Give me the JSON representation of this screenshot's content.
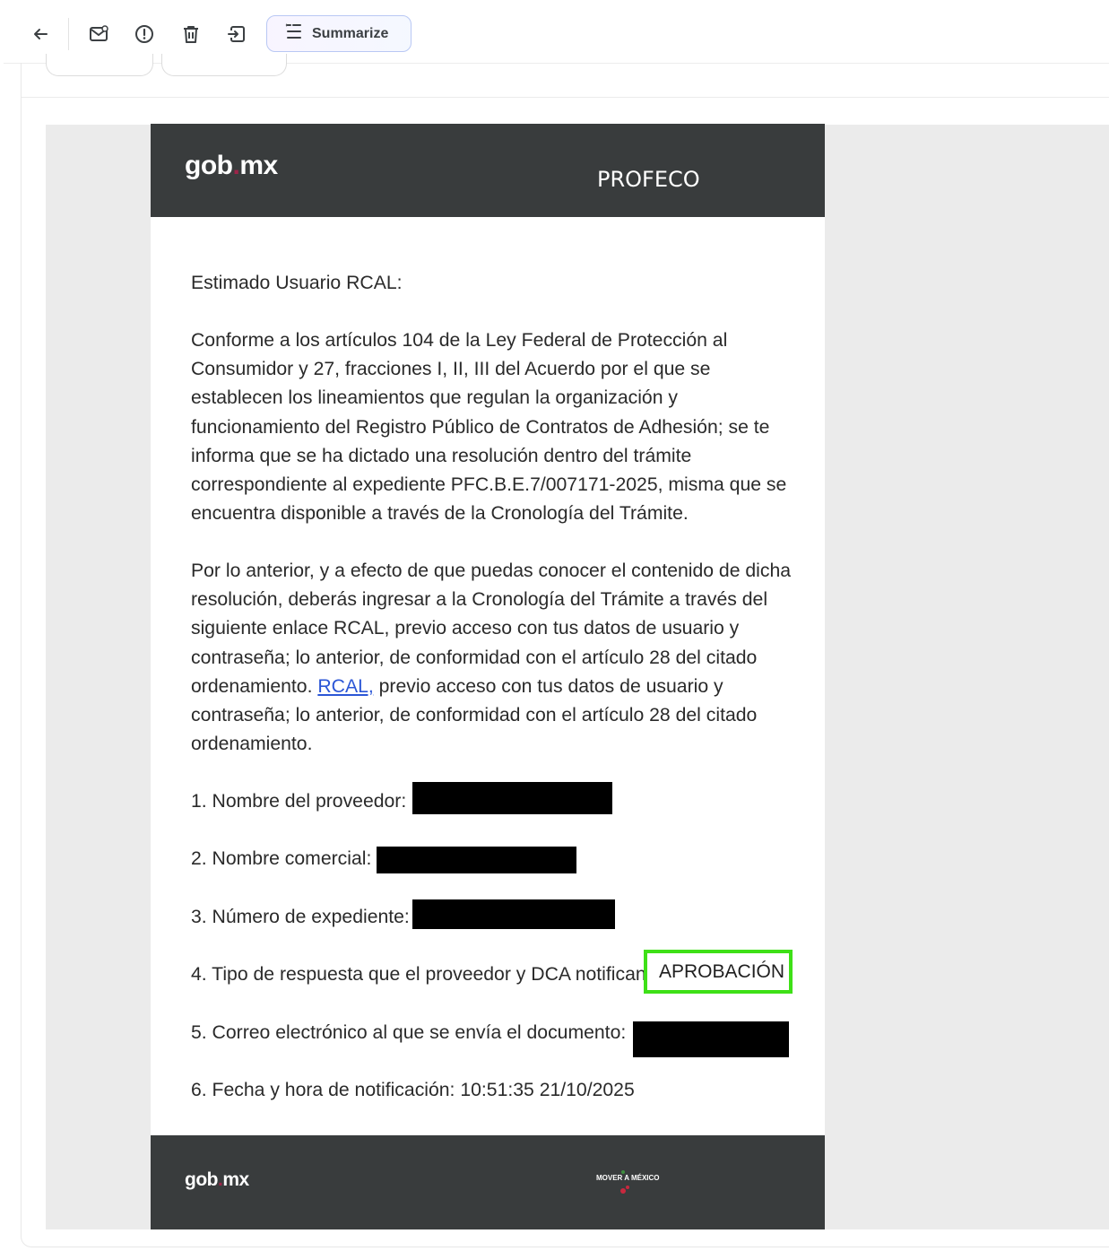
{
  "toolbar": {
    "back_icon": "arrow-left-icon",
    "mark_unread_icon": "mail-icon",
    "report_icon": "alert-circle-icon",
    "delete_icon": "trash-icon",
    "move_icon": "move-to-icon",
    "summarize_label": "Summarize"
  },
  "email": {
    "header_logo": "gob",
    "header_logo_2": "mx",
    "header_org": "PROFECO",
    "greeting": "Estimado Usuario RCAL:",
    "paragraph1": "Conforme a los artículos 104 de la Ley Federal de Protección al Consumidor y 27, fracciones I, II, III del Acuerdo por el que se establecen los lineamientos que regulan la organización y funcionamiento del Registro Público de Contratos de Adhesión; se te informa que se ha dictado una resolución dentro del trámite correspondiente al expediente PFC.B.E.7/007171-2025, misma que se encuentra disponible a través de la Cronología del Trámite.",
    "paragraph2_part1": "Por lo anterior, y a efecto de que puedas conocer el contenido de dicha resolución, deberás ingresar a la Cronología del Trámite a través del siguiente enlace RCAL, previo acceso con tus datos de usuario y contraseña; lo anterior, de conformidad con el artículo 28 del citado ordenamiento.",
    "link_label": "RCAL,",
    "paragraph2_part2": "previo acceso con tus datos de usuario y contraseña; lo anterior, de conformidad con el artículo 28 del citado ordenamiento.",
    "items": [
      {
        "label": "1. Nombre del proveedor:"
      },
      {
        "label": "2. Nombre comercial:"
      },
      {
        "label": "3. Número de expediente:"
      },
      {
        "label": "4. Tipo de respuesta que el proveedor y DCA notifican:"
      },
      {
        "label": "5. Correo electrónico al que se envía el documento:"
      },
      {
        "label": "6. Fecha y hora de notificación: 10:51:35 21/10/2025"
      }
    ],
    "approval_value": "APROBACIÓN",
    "footer_logo": "gob",
    "footer_logo_2": "mx",
    "footer_badge": "MOVER A MÉXICO"
  },
  "colors": {
    "header_bg": "#393c3d",
    "highlight_border": "#3ee017",
    "link": "#2b56d6"
  }
}
